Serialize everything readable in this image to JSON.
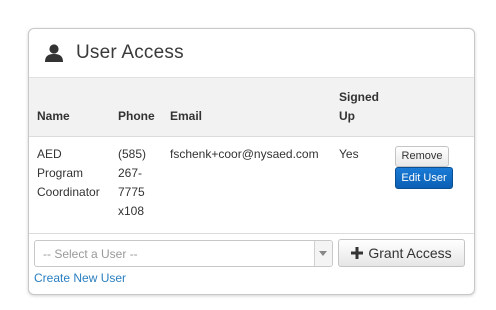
{
  "panel": {
    "title": "User Access",
    "title_icon": "user-icon"
  },
  "table": {
    "headers": {
      "name": "Name",
      "phone": "Phone",
      "email": "Email",
      "signed_up_line1": "Signed",
      "signed_up_line2": "Up"
    },
    "rows": [
      {
        "name_lines": [
          "AED",
          "Program",
          "Coordinator"
        ],
        "phone_lines": [
          "(585)",
          "267-",
          "7775",
          "x108"
        ],
        "email": "fschenk+coor@nysaed.com",
        "signed_up": "Yes",
        "remove_label": "Remove",
        "edit_label": "Edit User"
      }
    ]
  },
  "footer": {
    "select_placeholder": "-- Select a User --",
    "grant_label": "Grant Access",
    "create_link": "Create New User"
  },
  "colors": {
    "primary_button": "#0b5fb4",
    "link": "#2a7fc1",
    "header_bg": "#f2f2f2"
  }
}
